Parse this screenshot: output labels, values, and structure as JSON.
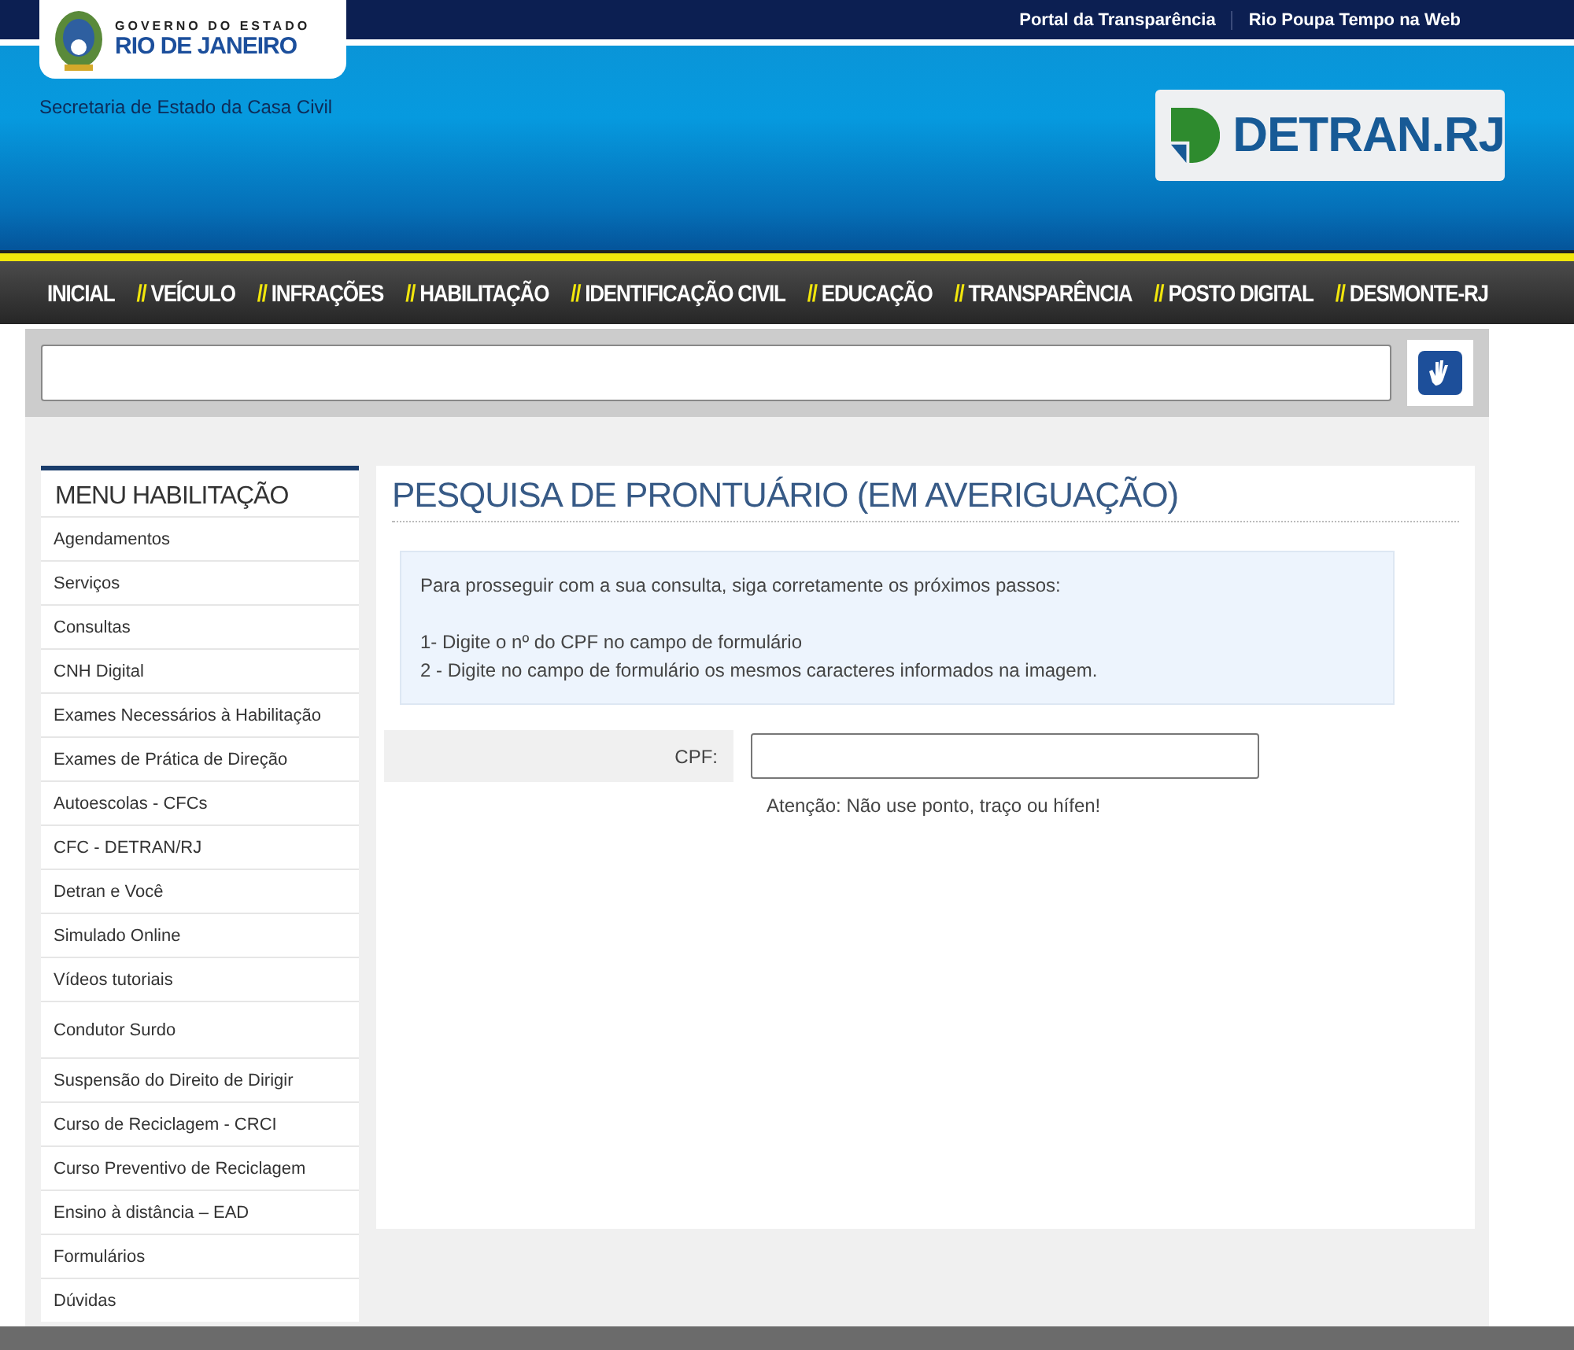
{
  "top_links": [
    "Portal da Transparência",
    "Rio Poupa Tempo na Web"
  ],
  "state_logo": {
    "line1": "GOVERNO DO ESTADO",
    "line2": "RIO DE JANEIRO"
  },
  "secretariat": "Secretaria de Estado da Casa Civil",
  "detran_logo": "DETRAN.RJ",
  "nav": [
    {
      "label": "INICIAL"
    },
    {
      "prefix": "//",
      "label": "VEÍCULO"
    },
    {
      "prefix": "//",
      "label": "INFRAÇÕES"
    },
    {
      "prefix": "//",
      "label": "HABILITAÇÃO"
    },
    {
      "prefix": "//",
      "label": "IDENTIFICAÇÃO CIVIL"
    },
    {
      "prefix": "//",
      "label": "EDUCAÇÃO"
    },
    {
      "prefix": "//",
      "label": "TRANSPARÊNCIA"
    },
    {
      "prefix": "//",
      "label": "POSTO DIGITAL"
    },
    {
      "prefix": "//",
      "label": "DESMONTE-RJ"
    }
  ],
  "sidebar": {
    "title": "MENU HABILITAÇÃO",
    "items": [
      {
        "label": "Agendamentos"
      },
      {
        "label": "Serviços"
      },
      {
        "label": "Consultas"
      },
      {
        "label": "CNH Digital"
      },
      {
        "label": "Exames Necessários à Habilitação"
      },
      {
        "label": "Exames de Prática de Direção"
      },
      {
        "label": "Autoescolas - CFCs"
      },
      {
        "label": "CFC - DETRAN/RJ"
      },
      {
        "label": "Detran e Você"
      },
      {
        "label": "Simulado Online"
      },
      {
        "label": "Vídeos tutoriais"
      },
      {
        "label": "Condutor Surdo",
        "tall": true
      },
      {
        "label": "Suspensão do Direito de Dirigir"
      },
      {
        "label": "Curso de Reciclagem - CRCI"
      },
      {
        "label": "Curso Preventivo de Reciclagem"
      },
      {
        "label": "Ensino à distância – EAD"
      },
      {
        "label": "Formulários"
      },
      {
        "label": "Dúvidas"
      }
    ]
  },
  "main": {
    "title": "PESQUISA DE PRONTUÁRIO (EM AVERIGUAÇÃO)",
    "info": [
      "Para prosseguir com a sua consulta, siga corretamente os próximos passos:",
      "1- Digite o nº do CPF no campo de formulário",
      "2 - Digite no campo de formulário os mesmos caracteres informados na imagem."
    ],
    "cpf_label": "CPF:",
    "cpf_hint": "Atenção: Não use ponto, traço ou hífen!"
  }
}
